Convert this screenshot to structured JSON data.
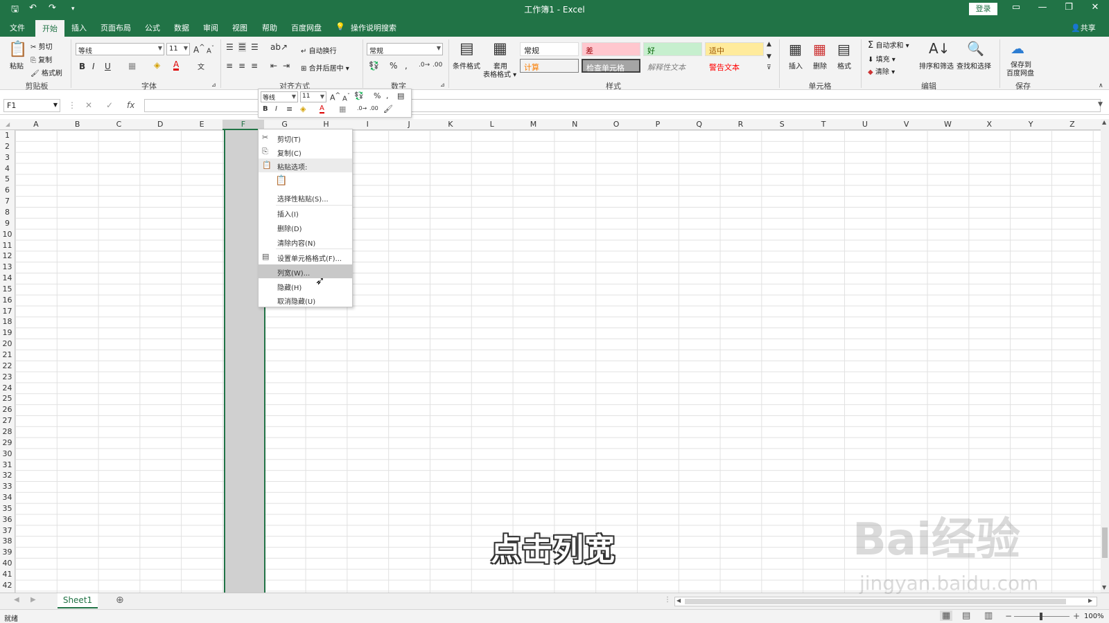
{
  "window": {
    "title": "工作簿1  -  Excel",
    "login": "登录",
    "share": "共享"
  },
  "tabs": [
    "文件",
    "开始",
    "插入",
    "页面布局",
    "公式",
    "数据",
    "审阅",
    "视图",
    "帮助",
    "百度网盘"
  ],
  "tell_me": "操作说明搜索",
  "clipboard": {
    "paste": "粘贴",
    "cut": "剪切",
    "copy": "复制",
    "format_painter": "格式刷",
    "label": "剪贴板"
  },
  "font": {
    "name": "等线",
    "size": "11",
    "label": "字体"
  },
  "alignment": {
    "wrap": "自动换行",
    "merge": "合并后居中",
    "label": "对齐方式"
  },
  "number": {
    "format": "常规",
    "label": "数字"
  },
  "styles": {
    "conditional": "条件格式",
    "table": "套用\n表格格式",
    "label": "样式",
    "cells": [
      {
        "text": "常规",
        "bg": "#ffffff",
        "fg": "#222222"
      },
      {
        "text": "差",
        "bg": "#ffc7ce",
        "fg": "#9c0006"
      },
      {
        "text": "好",
        "bg": "#c6efce",
        "fg": "#006100"
      },
      {
        "text": "适中",
        "bg": "#ffeb9c",
        "fg": "#9c5700"
      },
      {
        "text": "计算",
        "bg": "#f2f2f2",
        "fg": "#fa7d00"
      },
      {
        "text": "检查单元格",
        "bg": "#a5a5a5",
        "fg": "#ffffff"
      },
      {
        "text": "解释性文本",
        "bg": "#f3f3f3",
        "fg": "#7f7f7f"
      },
      {
        "text": "警告文本",
        "bg": "#f3f3f3",
        "fg": "#ff0000"
      }
    ]
  },
  "cells_group": {
    "insert": "插入",
    "delete": "删除",
    "format": "格式",
    "label": "单元格"
  },
  "editing": {
    "autosum": "自动求和",
    "fill": "填充",
    "clear": "清除",
    "sort": "排序和筛选",
    "find": "查找和选择",
    "label": "编辑"
  },
  "save_group": {
    "save": "保存到\n百度网盘",
    "label": "保存"
  },
  "formula_bar": {
    "name_box": "F1"
  },
  "columns": [
    "A",
    "B",
    "C",
    "D",
    "E",
    "F",
    "G",
    "H",
    "I",
    "J",
    "K",
    "L",
    "M",
    "N",
    "O",
    "P",
    "Q",
    "R",
    "S",
    "T",
    "U",
    "V",
    "W",
    "X",
    "Y",
    "Z"
  ],
  "selected_column": "F",
  "row_count": 42,
  "minitoolbar": {
    "font": "等线",
    "size": "11"
  },
  "context_menu": [
    {
      "label": "剪切(T)",
      "icon": "scissors-icon"
    },
    {
      "label": "复制(C)",
      "icon": "copy-icon"
    },
    {
      "label": "粘贴选项:",
      "icon": "paste-icon"
    },
    {
      "label": "选择性粘贴(S)...",
      "icon": ""
    },
    {
      "label": "插入(I)",
      "icon": ""
    },
    {
      "label": "删除(D)",
      "icon": ""
    },
    {
      "label": "清除内容(N)",
      "icon": ""
    },
    {
      "label": "设置单元格格式(F)...",
      "icon": "format-cells-icon"
    },
    {
      "label": "列宽(W)...",
      "icon": ""
    },
    {
      "label": "隐藏(H)",
      "icon": ""
    },
    {
      "label": "取消隐藏(U)",
      "icon": ""
    }
  ],
  "sheet": {
    "tab": "Sheet1"
  },
  "status": {
    "ready": "就绪",
    "zoom": "100%"
  },
  "caption": "点击列宽",
  "watermark": {
    "brand": "Bai经验",
    "url": "jingyan.baidu.com"
  }
}
